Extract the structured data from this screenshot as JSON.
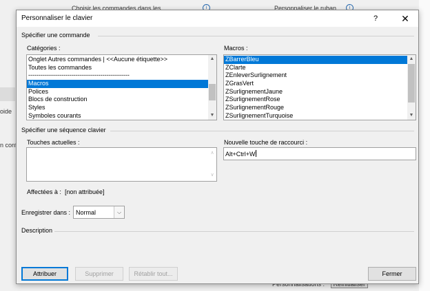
{
  "background": {
    "text_top_left": "Choisir les commandes dans les",
    "text_top_right": "Personnaliser le ruban",
    "text_left_1": "oide",
    "text_left_2": "n conf",
    "text_bottom": "Personnalisations :",
    "reset_label": "Réinitialiser"
  },
  "dialog": {
    "title": "Personnaliser le clavier",
    "help_label": "?",
    "close_label": "✕"
  },
  "commands": {
    "group_label": "Spécifier une commande",
    "categories_label": "Catégories :",
    "categories": [
      "Onglet Autres commandes | <<Aucune étiquette>>",
      "Toutes les commandes",
      "-------------------------------------------------",
      "Macros",
      "Polices",
      "Blocs de construction",
      "Styles",
      "Symboles courants"
    ],
    "categories_selected": 3,
    "macros_label": "Macros :",
    "macros": [
      "ZBarrerBleu",
      "ZClarte",
      "ZEnleverSurlignement",
      "ZGrasVert",
      "ZSurlignementJaune",
      "ZSurlignementRose",
      "ZSurlignementRouge",
      "ZSurlignementTurquoise"
    ],
    "macros_selected": 0
  },
  "keys": {
    "group_label": "Spécifier une séquence clavier",
    "current_label": "Touches actuelles :",
    "new_label": "Nouvelle touche de raccourci :",
    "new_value": "Alt+Ctrl+W",
    "assigned_label": "Affectées à :",
    "assigned_value": "[non attribuée]",
    "save_in_label": "Enregistrer dans :",
    "save_in_value": "Normal"
  },
  "description": {
    "label": "Description"
  },
  "buttons": {
    "assign": "Attribuer",
    "remove": "Supprimer",
    "reset": "Rétablir tout...",
    "close": "Fermer"
  },
  "colors": {
    "selection": "#0078d7",
    "default_button_border": "#0078d7"
  }
}
